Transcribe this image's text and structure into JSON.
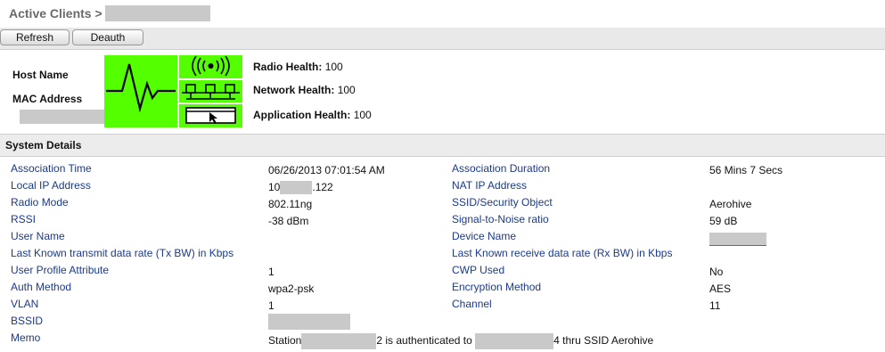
{
  "page": {
    "title": "Active Clients >"
  },
  "toolbar": {
    "refresh_label": "Refresh",
    "deauth_label": "Deauth"
  },
  "client": {
    "host_name_label": "Host Name",
    "mac_address_label": "MAC Address"
  },
  "health": {
    "radio_label": "Radio Health:",
    "radio_value": "100",
    "network_label": "Network Health:",
    "network_value": "100",
    "application_label": "Application Health:",
    "application_value": "100",
    "color": "#54ff00"
  },
  "system_details": {
    "header": "System Details",
    "rows": [
      {
        "l1": "Association Time",
        "v1": "06/26/2013 07:01:54 AM",
        "l2": "Association Duration",
        "v2": "56 Mins 7 Secs"
      },
      {
        "l1": "Local IP Address",
        "v1_prefix": "10",
        "v1_suffix": ".122",
        "l2": "NAT IP Address",
        "v2": ""
      },
      {
        "l1": "Radio Mode",
        "v1": "802.11ng",
        "l2": "SSID/Security Object",
        "v2": "Aerohive"
      },
      {
        "l1": "RSSI",
        "v1": "-38 dBm",
        "l2": "Signal-to-Noise ratio",
        "v2": "59 dB"
      },
      {
        "l1": "User Name",
        "v1": "",
        "l2": "Device Name",
        "v2": ""
      },
      {
        "l1": "Last Known transmit data rate (Tx BW) in Kbps",
        "v1": "",
        "l2": "Last Known receive data rate (Rx BW) in Kbps",
        "v2": ""
      },
      {
        "l1": "User Profile Attribute",
        "v1": "1",
        "l2": "CWP Used",
        "v2": "No"
      },
      {
        "l1": "Auth Method",
        "v1": "wpa2-psk",
        "l2": "Encryption Method",
        "v2": "AES"
      },
      {
        "l1": "VLAN",
        "v1": "1",
        "l2": "Channel",
        "v2": "11"
      },
      {
        "l1": "BSSID",
        "v1": "",
        "l2": "",
        "v2": ""
      },
      {
        "l1": "Memo",
        "memo_a": "Station",
        "memo_b": "2 is authenticated to",
        "memo_c": "4 thru SSID Aerohive"
      }
    ]
  },
  "icons": {
    "heartbeat": "heartbeat-icon",
    "radio": "wireless-signal-icon",
    "network": "network-nodes-icon",
    "application": "application-window-icon"
  }
}
